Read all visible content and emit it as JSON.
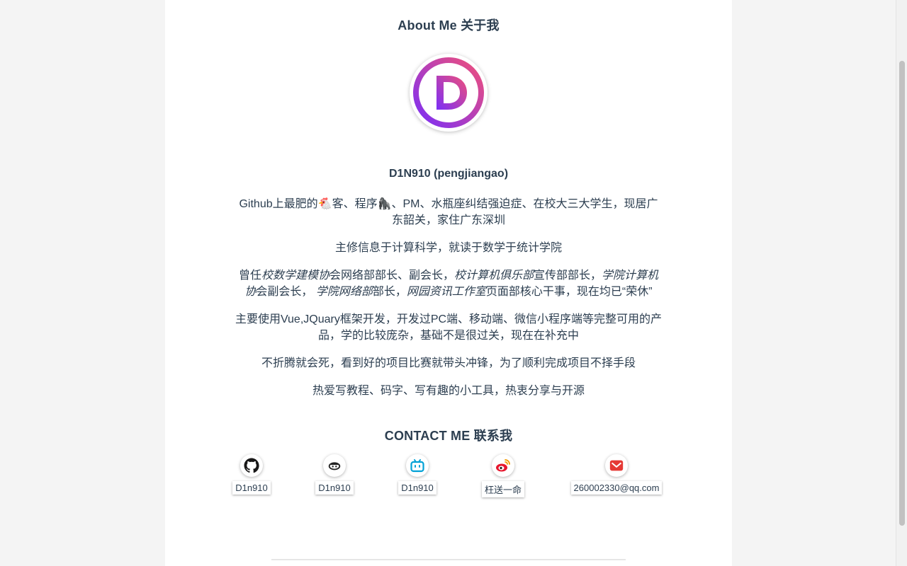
{
  "about": {
    "title": "About Me 关于我",
    "name": "D1N910 (pengjiangao)",
    "bio": {
      "p1_a": "Github上最肥的",
      "p1_b": "客、程序",
      "p1_c": "、PM、水瓶座纠结强迫症、在校大三大学生，现居广东韶关，家住广东深圳",
      "p2": "主修信息于计算科学，就读于数学于统计学院",
      "p3_a": "曾任",
      "p3_b": "校数学建模协",
      "p3_c": "会网络部部长、副会长，",
      "p3_d": "校计算机俱乐部",
      "p3_e": "宣传部部长，",
      "p3_f": "学院计算机协",
      "p3_g": "会副会长，",
      "p3_h": "学院网络部",
      "p3_i": "部长，",
      "p3_j": "网园资讯工作室",
      "p3_k": "页面部核心干事，现在均已“荣休”",
      "p4": "主要使用Vue,JQuary框架开发，开发过PC端、移动端、微信小程序端等完整可用的产品，学的比较庞杂，基础不是很过关，现在在补充中",
      "p5": "不折腾就会死，看到好的项目比赛就带头冲锋，为了顺利完成项目不择手段",
      "p6": "热爱写教程、码字、写有趣的小工具，热衷分享与开源"
    },
    "emoji_chicken": "🐔",
    "emoji_gorilla": "🦍"
  },
  "contact": {
    "title": "CONTACT ME 联系我",
    "items": [
      {
        "icon": "github-icon",
        "label": "D1n910"
      },
      {
        "icon": "juejin-icon",
        "label": "D1n910"
      },
      {
        "icon": "bilibili-icon",
        "label": "D1n910"
      },
      {
        "icon": "weibo-icon",
        "label": "枉送一命"
      },
      {
        "icon": "mail-icon",
        "label": "260002330@qq.com"
      }
    ]
  },
  "colors": {
    "text": "#2c3e50",
    "avatar_gradient_start": "#7b2ff7",
    "avatar_gradient_end": "#f0507a",
    "weibo": "#e6162d",
    "bilibili": "#00a1d6",
    "mail": "#e53935"
  }
}
